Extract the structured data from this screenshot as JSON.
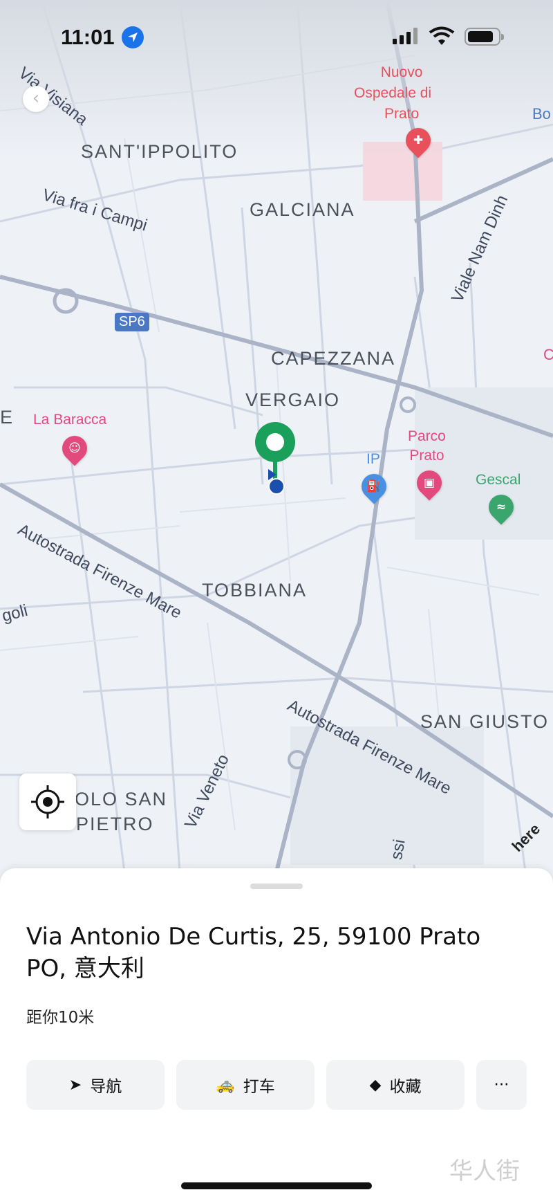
{
  "status": {
    "time": "11:01",
    "location_icon": "location-arrow-icon",
    "signal_icon": "cellular-signal-icon",
    "wifi_icon": "wifi-icon",
    "battery_icon": "battery-icon"
  },
  "map": {
    "districts": [
      "SANT'IPPOLITO",
      "GALCIANA",
      "CAPEZZANA",
      "VERGAIO",
      "TOBBIANA",
      "SAN GIUSTO",
      "OLO SAN",
      "PIETRO",
      "E"
    ],
    "roads": [
      "Via Visiana",
      "Via fra i Campi",
      "Viale Nam Dinh",
      "Autostrada Firenze Mare",
      "Autostrada Firenze Mare",
      "Via Veneto",
      "goli",
      "ssi"
    ],
    "road_shield": "SP6",
    "pois": [
      {
        "name": "Nuovo Ospedale di Prato",
        "lines": [
          "Nuovo",
          "Ospedale di",
          "Prato"
        ],
        "color": "#e8505b",
        "icon": "hospital-icon"
      },
      {
        "name": "La Baracca",
        "color": "#e24a7e",
        "icon": "theater-icon"
      },
      {
        "name": "Parco Prato",
        "lines": [
          "Parco",
          "Prato"
        ],
        "color": "#e24a7e",
        "icon": "shopping-bag-icon"
      },
      {
        "name": "IP",
        "color": "#4a90e2",
        "icon": "fuel-icon"
      },
      {
        "name": "Gescal",
        "color": "#3aa66e",
        "icon": "swimming-icon"
      }
    ],
    "edge_labels": [
      "Bo",
      "C"
    ],
    "attribution": "here"
  },
  "place": {
    "address": "Via Antonio De Curtis, 25, 59100 Prato PO, 意大利",
    "distance": "距你10米"
  },
  "actions": [
    {
      "label": "导航",
      "icon": "navigate-arrow-icon"
    },
    {
      "label": "打车",
      "icon": "taxi-icon"
    },
    {
      "label": "收藏",
      "icon": "cube-icon"
    },
    {
      "label": "···",
      "icon": "more-icon"
    }
  ],
  "watermark": "华人街"
}
